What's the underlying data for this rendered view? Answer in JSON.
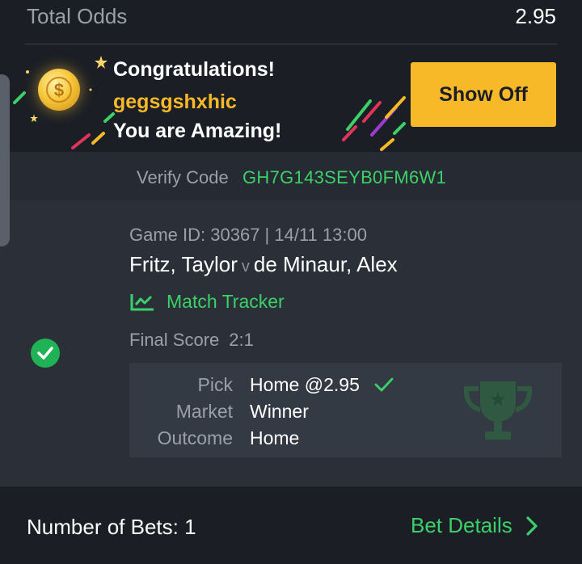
{
  "summary": {
    "total_odds_label": "Total Odds",
    "total_odds_value": "2.95"
  },
  "congrats": {
    "title": "Congratulations!",
    "username": "gegsgshxhic",
    "subtitle": "You are Amazing!",
    "show_off_label": "Show Off",
    "coin_symbol": "$"
  },
  "verify": {
    "label": "Verify Code",
    "code": "GH7G143SEYB0FM6W1"
  },
  "bet": {
    "game_info": "Game ID: 30367 | 14/11 13:00",
    "home": "Fritz, Taylor",
    "versus": "v",
    "away": "de Minaur, Alex",
    "tracker_label": "Match Tracker",
    "final_score_label": "Final Score",
    "final_score_value": "2:1",
    "pick_label": "Pick",
    "pick_value": "Home @2.95",
    "market_label": "Market",
    "market_value": "Winner",
    "outcome_label": "Outcome",
    "outcome_value": "Home",
    "status": "won"
  },
  "footer": {
    "number_of_bets": "Number of Bets: 1",
    "bet_details_label": "Bet Details"
  },
  "colors": {
    "accent_green": "#3cd168",
    "accent_yellow": "#f7b928",
    "background": "#1b1e25"
  },
  "icons": [
    "coin-icon",
    "check-circle-icon",
    "match-tracker-icon",
    "checkmark-icon",
    "trophy-icon",
    "chevron-right-icon"
  ]
}
